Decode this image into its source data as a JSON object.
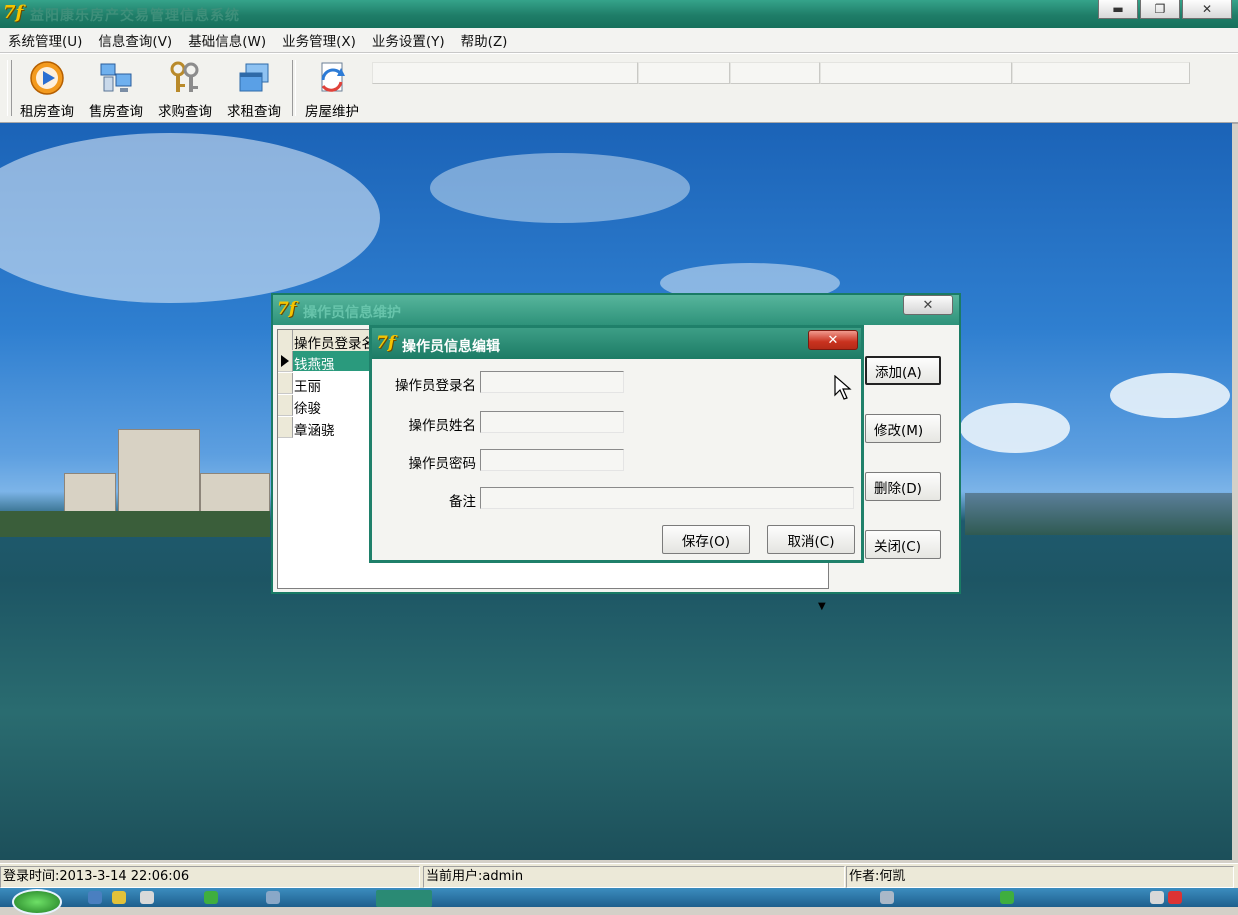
{
  "app": {
    "title": "益阳康乐房产交易管理信息系统",
    "logo_text": "7f"
  },
  "menu": [
    {
      "label": "系统管理(U)"
    },
    {
      "label": "信息查询(V)"
    },
    {
      "label": "基础信息(W)"
    },
    {
      "label": "业务管理(X)"
    },
    {
      "label": "业务设置(Y)"
    },
    {
      "label": "帮助(Z)"
    }
  ],
  "toolbar": [
    {
      "label": "租房查询",
      "icon": "play-icon"
    },
    {
      "label": "售房查询",
      "icon": "computers-icon"
    },
    {
      "label": "求购查询",
      "icon": "keys-icon"
    },
    {
      "label": "求租查询",
      "icon": "windows-icon"
    },
    {
      "label": "房屋维护",
      "icon": "refresh-doc-icon"
    }
  ],
  "back_dialog": {
    "title": "操作员信息维护",
    "column_header": "操作员登录名",
    "rows": [
      "钱燕强",
      "王丽",
      "徐骏",
      "章涵骁"
    ],
    "selected_row": 0,
    "buttons": {
      "add": "添加(A)",
      "edit": "修改(M)",
      "delete": "删除(D)",
      "close": "关闭(C)"
    }
  },
  "front_dialog": {
    "title": "操作员信息编辑",
    "fields": {
      "login_label": "操作员登录名",
      "login_value": "",
      "name_label": "操作员姓名",
      "name_value": "",
      "password_label": "操作员密码",
      "password_value": "",
      "note_label": "备注",
      "note_value": ""
    },
    "buttons": {
      "save": "保存(O)",
      "cancel": "取消(C)"
    }
  },
  "status": {
    "login_time": "登录时间:2013-3-14 22:06:06",
    "current_user": "当前用户:admin",
    "author": "作者:何凯"
  },
  "colors": {
    "title_green": "#1f7d68",
    "selection": "#2a9a7d",
    "close_red": "#c9321f"
  }
}
